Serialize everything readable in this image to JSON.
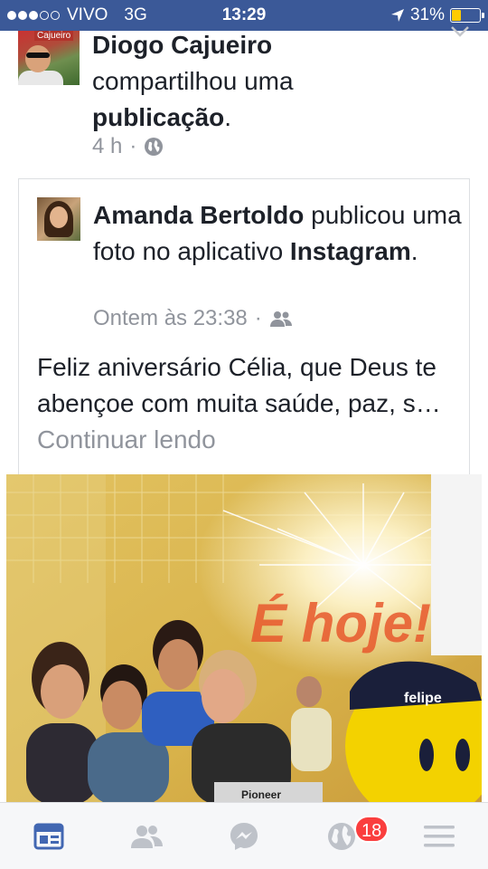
{
  "status_bar": {
    "carrier": "VIVO",
    "network": "3G",
    "time": "13:29",
    "battery": "31%",
    "battery_level": 0.31,
    "signal_bars_filled": 3,
    "signal_bars_total": 5
  },
  "post": {
    "author": "Diogo Cajueiro",
    "avatar_tag": "Cajueiro",
    "action_text": "compartilhou uma",
    "object": "publicação",
    "period": ".",
    "time": "4 h",
    "separator": "·",
    "privacy_icon": "globe-icon"
  },
  "shared_post": {
    "author": "Amanda Bertoldo",
    "action_text": "publicou uma foto no aplicativo",
    "app": "Instagram",
    "period": ".",
    "time": "Ontem às 23:38",
    "separator": "·",
    "privacy_icon": "friends-icon",
    "body": "Feliz aniversário Célia, que Deus te abençoe com muita saúde, paz, s…",
    "continue_label": "Continuar lendo"
  },
  "photo": {
    "overlay_text": "É hoje!",
    "logo_text": "felipe",
    "brand_text": "Pioneer"
  },
  "tab_bar": {
    "items": [
      {
        "icon": "news-feed-icon",
        "active": true
      },
      {
        "icon": "friend-requests-icon",
        "active": false
      },
      {
        "icon": "messenger-icon",
        "active": false
      },
      {
        "icon": "notifications-globe-icon",
        "active": false
      },
      {
        "icon": "menu-icon",
        "active": false
      }
    ],
    "notifications_badge": "18"
  },
  "colors": {
    "brand": "#3b5998",
    "badge": "#fa3e3e",
    "muted_text": "#90949c",
    "active_tab": "#4267b2"
  }
}
